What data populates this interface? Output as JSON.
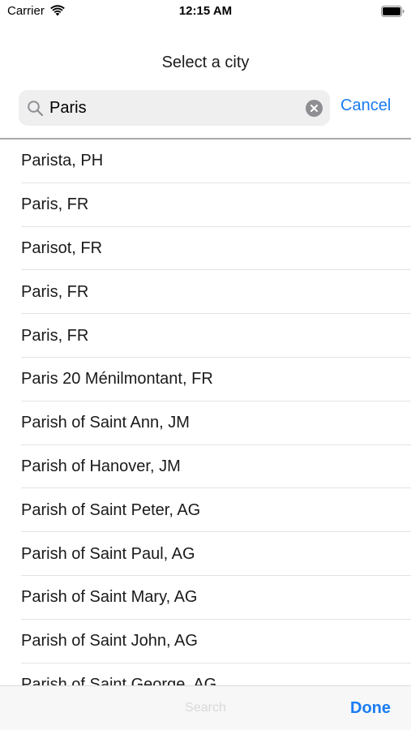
{
  "status_bar": {
    "carrier": "Carrier",
    "time": "12:15 AM"
  },
  "header": {
    "title": "Select a city"
  },
  "search": {
    "value": "Paris",
    "cancel_label": "Cancel"
  },
  "results": [
    "Parista, PH",
    "Paris, FR",
    "Parisot, FR",
    "Paris, FR",
    "Paris, FR",
    "Paris 20 Ménilmontant, FR",
    "Parish of Saint Ann, JM",
    "Parish of Hanover, JM",
    "Parish of Saint Peter, AG",
    "Parish of Saint Paul, AG",
    "Parish of Saint Mary, AG",
    "Parish of Saint John, AG",
    "Parish of Saint George, AG"
  ],
  "toolbar": {
    "center_label": "Search",
    "done_label": "Done"
  },
  "colors": {
    "accent": "#1a7cf2",
    "search_bg": "#efeff0",
    "separator": "#e3e3e6"
  }
}
